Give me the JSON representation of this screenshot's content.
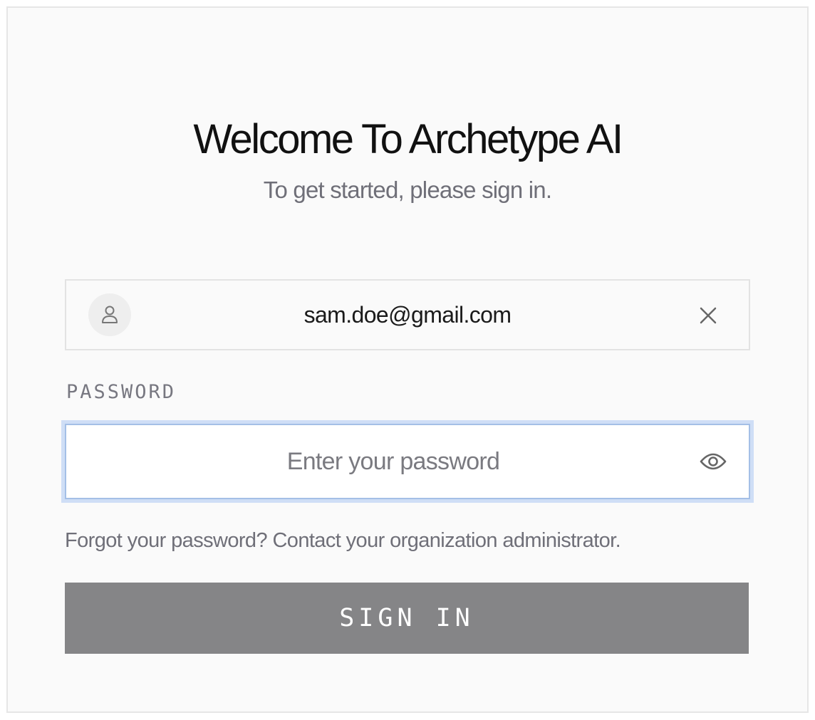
{
  "header": {
    "title": "Welcome To Archetype AI",
    "subtitle": "To get started, please sign in."
  },
  "email": {
    "value": "sam.doe@gmail.com",
    "avatar_icon": "user-icon",
    "clear_icon": "close-icon"
  },
  "password": {
    "label": "PASSWORD",
    "placeholder": "Enter your password",
    "value": "",
    "toggle_icon": "eye-icon"
  },
  "help": {
    "forgot_text": "Forgot your password? Contact your organization administrator."
  },
  "actions": {
    "sign_in_label": "SIGN IN"
  },
  "colors": {
    "focus_ring": "#cfdef6",
    "button_bg": "#858587",
    "muted_text": "#6f6f78"
  }
}
